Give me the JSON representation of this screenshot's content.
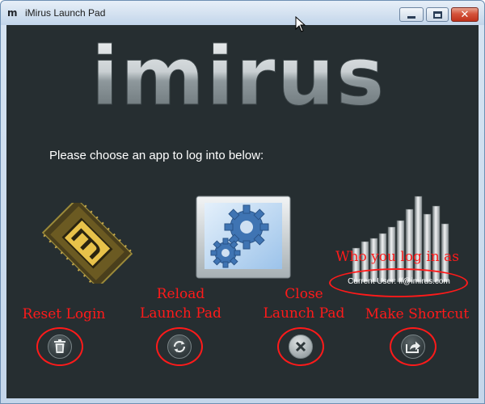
{
  "window": {
    "title": "iMirus Launch Pad",
    "app_icon_glyph": "m"
  },
  "titlebar_buttons": {
    "minimize_icon": "minimize-icon",
    "maximize_icon": "maximize-icon",
    "close_icon": "close-icon",
    "close_glyph": "✕"
  },
  "logo": {
    "text": "imirus"
  },
  "prompt": "Please choose an app to log into below:",
  "apps": [
    {
      "icon": "chip-m-icon"
    },
    {
      "icon": "gears-icon"
    },
    {
      "icon": "bar-chart-icon"
    }
  ],
  "current_user": "Current User: ff@imirus.com",
  "annotations": {
    "who": "Who you log in as",
    "reload_line1": "Reload",
    "reload_line2": "Launch Pad",
    "close_line1": "Close",
    "close_line2": "Launch Pad",
    "reset": "Reset Login",
    "shortcut": "Make Shortcut"
  },
  "actions": [
    {
      "name": "reset-login",
      "icon": "trash-icon"
    },
    {
      "name": "reload-launch-pad",
      "icon": "refresh-icon"
    },
    {
      "name": "close-launch-pad",
      "icon": "close-x-icon"
    },
    {
      "name": "make-shortcut",
      "icon": "share-arrow-icon"
    }
  ],
  "colors": {
    "background": "#262e31",
    "annotation": "#ff1a1a",
    "text": "#ffffff",
    "chip_gold": "#e8c24a"
  }
}
